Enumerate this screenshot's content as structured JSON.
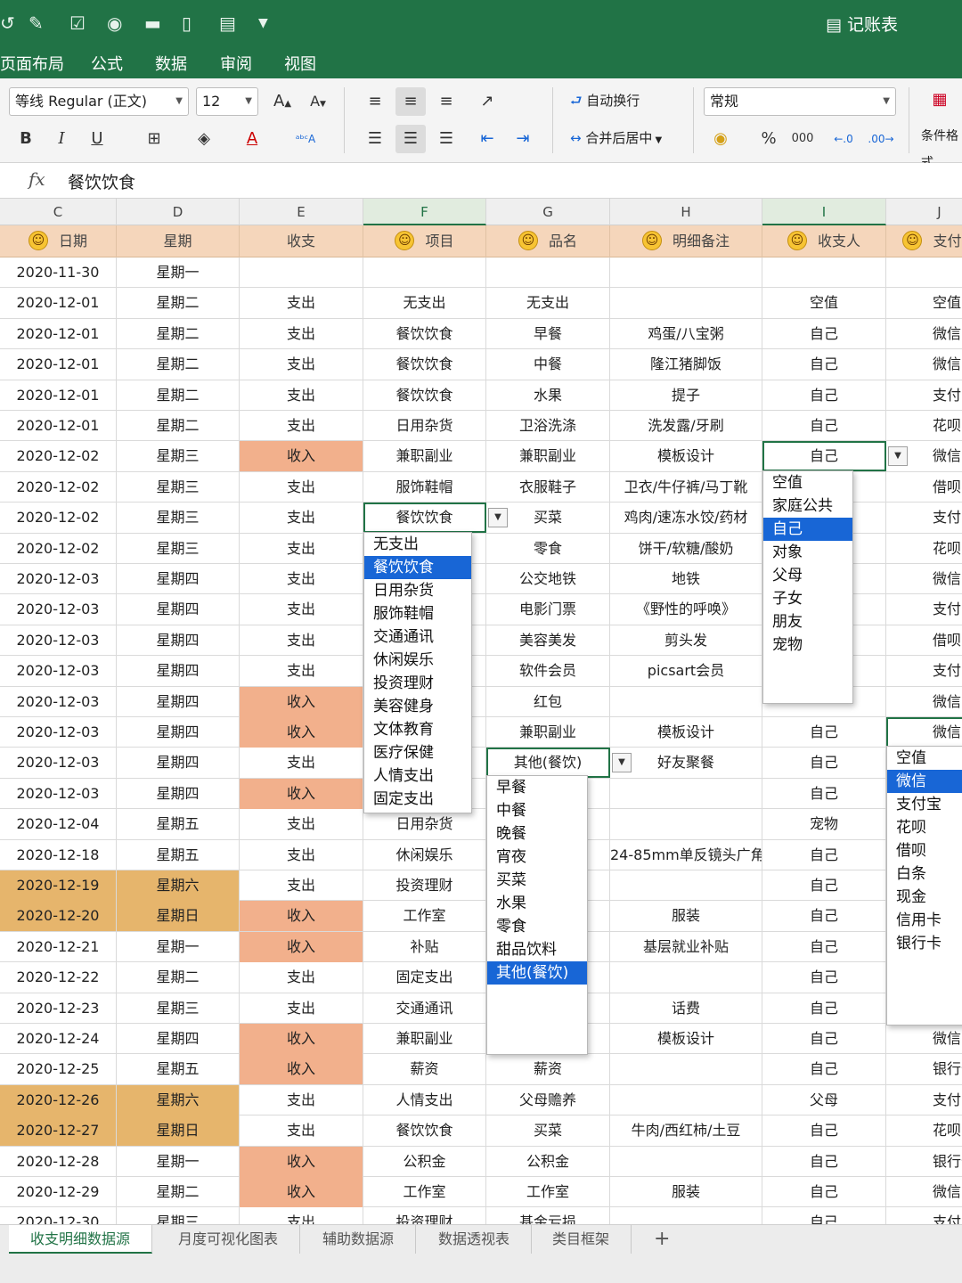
{
  "window": {
    "title": "记账表"
  },
  "menu": [
    "页面布局",
    "公式",
    "数据",
    "审阅",
    "视图"
  ],
  "ribbon": {
    "font_name": "等线 Regular (正文)",
    "font_size": "12",
    "grow_font": "A",
    "shrink_font": "A",
    "bold": "B",
    "italic": "I",
    "underline": "U",
    "wrap_text": "自动换行",
    "merge_center": "合并后居中",
    "number_format": "常规",
    "percent": "%",
    "thousands": "000",
    "cond_format": "条件格式"
  },
  "formula_bar": {
    "fx": "fx",
    "value": "餐饮饮食"
  },
  "columns": [
    "C",
    "D",
    "E",
    "F",
    "G",
    "H",
    "I",
    "J"
  ],
  "headers": [
    "日期",
    "星期",
    "收支",
    "项目",
    "品名",
    "明细备注",
    "收支人",
    "支付方"
  ],
  "rows": [
    {
      "c": [
        "2020-11-30",
        "星期一",
        "",
        "",
        "",
        "",
        "",
        ""
      ]
    },
    {
      "c": [
        "2020-12-01",
        "星期二",
        "支出",
        "无支出",
        "无支出",
        "",
        "空值",
        "空值"
      ]
    },
    {
      "c": [
        "2020-12-01",
        "星期二",
        "支出",
        "餐饮饮食",
        "早餐",
        "鸡蛋/八宝粥",
        "自己",
        "微信"
      ]
    },
    {
      "c": [
        "2020-12-01",
        "星期二",
        "支出",
        "餐饮饮食",
        "中餐",
        "隆江猪脚饭",
        "自己",
        "微信"
      ]
    },
    {
      "c": [
        "2020-12-01",
        "星期二",
        "支出",
        "餐饮饮食",
        "水果",
        "提子",
        "自己",
        "支付宝"
      ]
    },
    {
      "c": [
        "2020-12-01",
        "星期二",
        "支出",
        "日用杂货",
        "卫浴洗涤",
        "洗发露/牙刷",
        "自己",
        "花呗"
      ]
    },
    {
      "c": [
        "2020-12-02",
        "星期三",
        "收入",
        "兼职副业",
        "兼职副业",
        "模板设计",
        "自己",
        "微信"
      ]
    },
    {
      "c": [
        "2020-12-02",
        "星期三",
        "支出",
        "服饰鞋帽",
        "衣服鞋子",
        "卫衣/牛仔裤/马丁靴",
        "",
        "借呗"
      ]
    },
    {
      "c": [
        "2020-12-02",
        "星期三",
        "支出",
        "餐饮饮食",
        "买菜",
        "鸡肉/速冻水饺/药材",
        "",
        "支付宝"
      ]
    },
    {
      "c": [
        "2020-12-02",
        "星期三",
        "支出",
        "",
        "零食",
        "饼干/软糖/酸奶",
        "",
        "花呗"
      ]
    },
    {
      "c": [
        "2020-12-03",
        "星期四",
        "支出",
        "",
        "公交地铁",
        "地铁",
        "",
        "微信"
      ]
    },
    {
      "c": [
        "2020-12-03",
        "星期四",
        "支出",
        "",
        "电影门票",
        "《野性的呼唤》",
        "",
        "支付宝"
      ]
    },
    {
      "c": [
        "2020-12-03",
        "星期四",
        "支出",
        "",
        "美容美发",
        "剪头发",
        "",
        "借呗"
      ]
    },
    {
      "c": [
        "2020-12-03",
        "星期四",
        "支出",
        "",
        "软件会员",
        "picsart会员",
        "",
        "支付宝"
      ]
    },
    {
      "c": [
        "2020-12-03",
        "星期四",
        "收入",
        "",
        "红包",
        "",
        "",
        "微信"
      ]
    },
    {
      "c": [
        "2020-12-03",
        "星期四",
        "收入",
        "",
        "兼职副业",
        "模板设计",
        "自己",
        "微信"
      ]
    },
    {
      "c": [
        "2020-12-03",
        "星期四",
        "支出",
        "",
        "其他(餐饮)",
        "好友聚餐",
        "自己",
        ""
      ]
    },
    {
      "c": [
        "2020-12-03",
        "星期四",
        "收入",
        "",
        "",
        "",
        "自己",
        ""
      ]
    },
    {
      "c": [
        "2020-12-04",
        "星期五",
        "支出",
        "日用杂货",
        "",
        "",
        "宠物",
        ""
      ]
    },
    {
      "c": [
        "2020-12-18",
        "星期五",
        "支出",
        "休闲娱乐",
        "",
        "24-85mm单反镜头广角",
        "自己",
        ""
      ]
    },
    {
      "c": [
        "2020-12-19",
        "星期六",
        "支出",
        "投资理财",
        "",
        "",
        "自己",
        ""
      ]
    },
    {
      "c": [
        "2020-12-20",
        "星期日",
        "收入",
        "工作室",
        "",
        "服装",
        "自己",
        ""
      ]
    },
    {
      "c": [
        "2020-12-21",
        "星期一",
        "收入",
        "补贴",
        "",
        "基层就业补贴",
        "自己",
        ""
      ]
    },
    {
      "c": [
        "2020-12-22",
        "星期二",
        "支出",
        "固定支出",
        "",
        "",
        "自己",
        ""
      ]
    },
    {
      "c": [
        "2020-12-23",
        "星期三",
        "支出",
        "交通通讯",
        "",
        "话费",
        "自己",
        ""
      ]
    },
    {
      "c": [
        "2020-12-24",
        "星期四",
        "收入",
        "兼职副业",
        "",
        "模板设计",
        "自己",
        "微信"
      ]
    },
    {
      "c": [
        "2020-12-25",
        "星期五",
        "收入",
        "薪资",
        "薪资",
        "",
        "自己",
        "银行卡"
      ]
    },
    {
      "c": [
        "2020-12-26",
        "星期六",
        "支出",
        "人情支出",
        "父母赡养",
        "",
        "父母",
        "支付宝"
      ]
    },
    {
      "c": [
        "2020-12-27",
        "星期日",
        "支出",
        "餐饮饮食",
        "买菜",
        "牛肉/西红柿/土豆",
        "自己",
        "花呗"
      ]
    },
    {
      "c": [
        "2020-12-28",
        "星期一",
        "收入",
        "公积金",
        "公积金",
        "",
        "自己",
        "银行卡"
      ]
    },
    {
      "c": [
        "2020-12-29",
        "星期二",
        "收入",
        "工作室",
        "工作室",
        "服装",
        "自己",
        "微信"
      ]
    },
    {
      "c": [
        "2020-12-30",
        "星期三",
        "支出",
        "投资理财",
        "基金亏损",
        "",
        "自己",
        "支付宝"
      ]
    }
  ],
  "dropdown_item": {
    "items": [
      "无支出",
      "餐饮饮食",
      "日用杂货",
      "服饰鞋帽",
      "交通通讯",
      "休闲娱乐",
      "投资理财",
      "美容健身",
      "文体教育",
      "医疗保健",
      "人情支出",
      "固定支出"
    ],
    "selected": "餐饮饮食"
  },
  "dropdown_product": {
    "items": [
      "早餐",
      "中餐",
      "晚餐",
      "宵夜",
      "买菜",
      "水果",
      "零食",
      "甜品饮料",
      "其他(餐饮)"
    ],
    "selected": "其他(餐饮)"
  },
  "dropdown_payer": {
    "items": [
      "空值",
      "家庭公共",
      "自己",
      "对象",
      "父母",
      "子女",
      "朋友",
      "宠物"
    ],
    "selected": "自己"
  },
  "dropdown_payment": {
    "items": [
      "空值",
      "微信",
      "支付宝",
      "花呗",
      "借呗",
      "白条",
      "现金",
      "信用卡",
      "银行卡"
    ],
    "selected": "微信"
  },
  "sheet_tabs": [
    "收支明细数据源",
    "月度可视化图表",
    "辅助数据源",
    "数据透视表",
    "类目框架"
  ],
  "add_sheet": "+",
  "colors": {
    "ribbon_green": "#217346",
    "header_fill": "#f5d6bb",
    "income_fill": "#f2b08c",
    "weekend_fill": "#e6b56c",
    "dropdown_highlight": "#1866d6"
  }
}
